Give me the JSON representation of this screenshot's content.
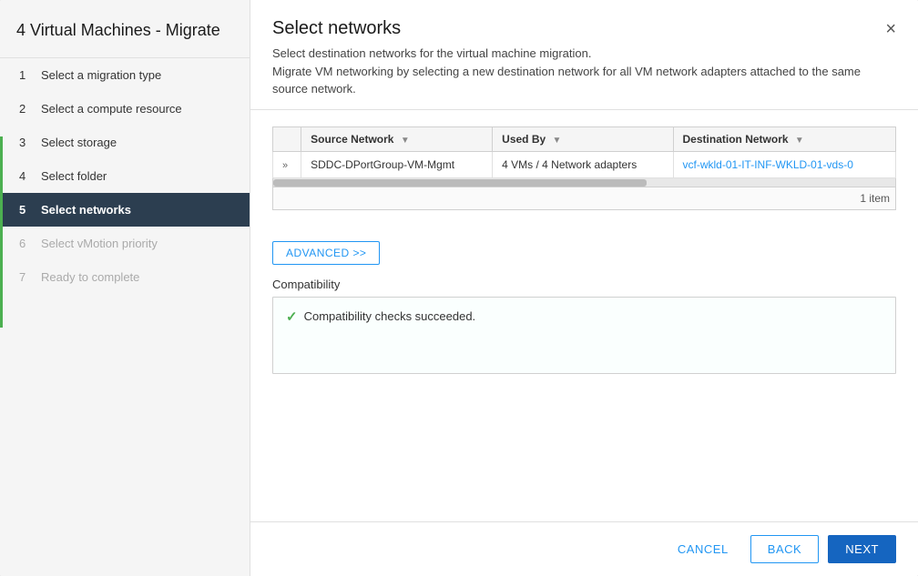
{
  "sidebar": {
    "title": "4 Virtual Machines - Migrate",
    "steps": [
      {
        "num": "1",
        "label": "Select a migration type",
        "state": "completed"
      },
      {
        "num": "2",
        "label": "Select a compute resource",
        "state": "completed"
      },
      {
        "num": "3",
        "label": "Select storage",
        "state": "completed"
      },
      {
        "num": "4",
        "label": "Select folder",
        "state": "completed"
      },
      {
        "num": "5",
        "label": "Select networks",
        "state": "active"
      },
      {
        "num": "6",
        "label": "Select vMotion priority",
        "state": "disabled"
      },
      {
        "num": "7",
        "label": "Ready to complete",
        "state": "disabled"
      }
    ]
  },
  "main": {
    "title": "Select networks",
    "close_label": "×",
    "desc_line1": "Select destination networks for the virtual machine migration.",
    "desc_line2": "Migrate VM networking by selecting a new destination network for all VM network adapters attached to the same source network.",
    "table": {
      "columns": [
        {
          "key": "expand",
          "label": ""
        },
        {
          "key": "source",
          "label": "Source Network",
          "sort": true
        },
        {
          "key": "used_by",
          "label": "Used By",
          "sort": true
        },
        {
          "key": "destination",
          "label": "Destination Network",
          "sort": true
        }
      ],
      "rows": [
        {
          "expand": "»",
          "source": "SDDC-DPortGroup-VM-Mgmt",
          "used_by": "4 VMs / 4 Network adapters",
          "destination": "vcf-wkld-01-IT-INF-WKLD-01-vds-0"
        }
      ],
      "footer": "1 item"
    },
    "advanced_btn": "ADVANCED >>",
    "compatibility_label": "Compatibility",
    "compatibility_text": "Compatibility checks succeeded."
  },
  "footer": {
    "cancel": "CANCEL",
    "back": "BACK",
    "next": "NEXT"
  }
}
